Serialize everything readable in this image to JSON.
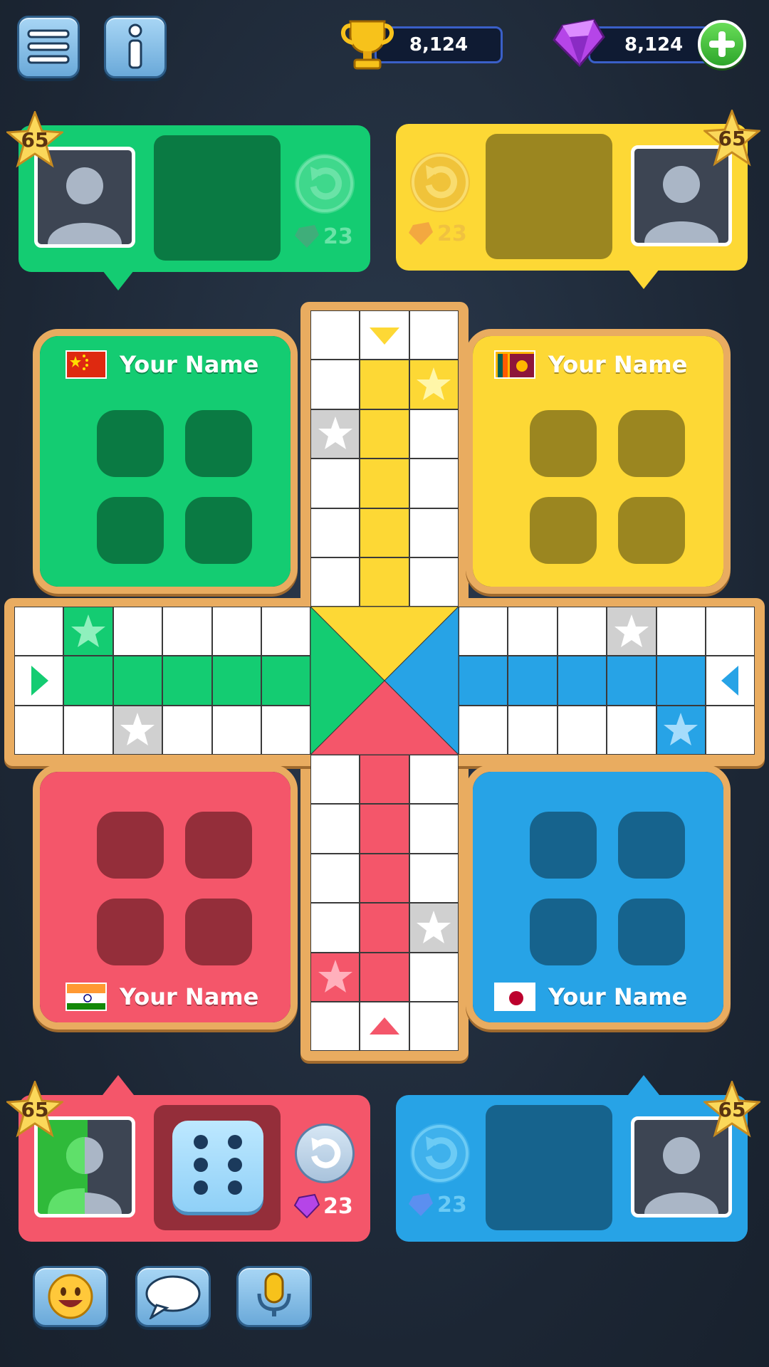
{
  "topbar": {
    "trophies": "8,124",
    "gems": "8,124"
  },
  "players": {
    "green": {
      "level": "65",
      "gems": "23",
      "name": "Your Name",
      "flag": "china"
    },
    "yellow": {
      "level": "65",
      "gems": "23",
      "name": "Your Name",
      "flag": "sri-lanka"
    },
    "red": {
      "level": "65",
      "gems": "23",
      "name": "Your Name",
      "flag": "india",
      "dice_value": 6
    },
    "blue": {
      "level": "65",
      "gems": "23",
      "name": "Your Name",
      "flag": "japan"
    }
  },
  "colors": {
    "green": "#14cc72",
    "yellow": "#fdd835",
    "red": "#f4566a",
    "blue": "#27a3e6",
    "board_border": "#e9ac60"
  },
  "icons": [
    "menu-icon",
    "info-icon",
    "trophy-icon",
    "gem-icon",
    "plus-icon",
    "refresh-icon",
    "star-icon",
    "emoji-icon",
    "chat-icon",
    "microphone-icon"
  ]
}
